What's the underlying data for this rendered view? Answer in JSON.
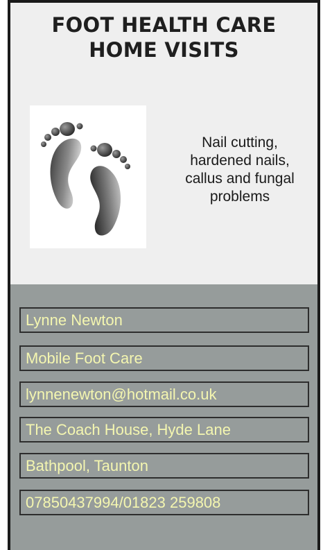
{
  "heading": {
    "line1": "FOOT HEALTH CARE",
    "line2": "HOME VISITS"
  },
  "logo": {
    "icon": "footprints-icon"
  },
  "tagline": {
    "line1": "Nail  cutting,",
    "line2": "hardened nails,",
    "line3": "callus and fungal",
    "line4": "problems"
  },
  "contact": {
    "name": "Lynne Newton",
    "business": "Mobile Foot Care",
    "email": "lynnenewton@hotmail.co.uk",
    "address_line1": "The Coach House, Hyde Lane",
    "address_line2": "Bathpool, Taunton",
    "phone": "07850437994/01823 259808"
  },
  "colors": {
    "top_background": "#efefef",
    "bottom_background": "#969c9b",
    "field_text": "#f4f6b0",
    "border": "#1a1a1a"
  }
}
